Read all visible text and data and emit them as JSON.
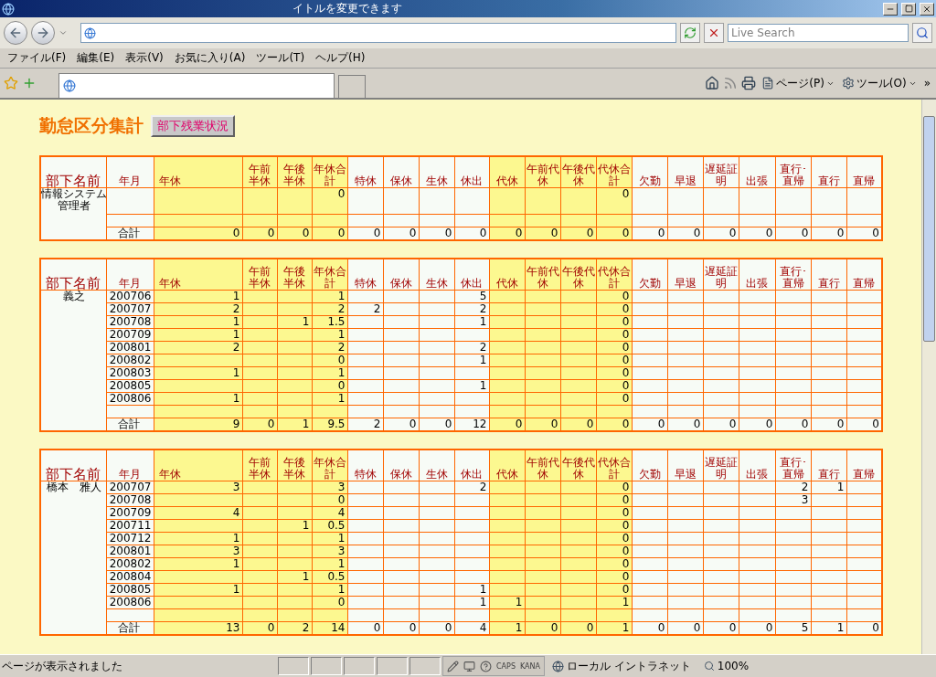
{
  "browser": {
    "title": "イトルを変更できます",
    "search_placeholder": "Live Search",
    "menu": [
      "ファイル(F)",
      "編集(E)",
      "表示(V)",
      "お気に入り(A)",
      "ツール(T)",
      "ヘルプ(H)"
    ],
    "command_bar": [
      {
        "kind": "page",
        "label": "ページ(P)"
      },
      {
        "kind": "tools",
        "label": "ツール(O)"
      }
    ],
    "more": "»"
  },
  "page": {
    "title": "勤怠区分集計",
    "button": "部下残業状況"
  },
  "groups": [
    {
      "name_header": "部下名前",
      "month_header": "年月",
      "name": "情報システム管理者",
      "columns": [
        {
          "label": "年休",
          "highlight": true
        },
        {
          "label": "午前半休",
          "highlight": true
        },
        {
          "label": "午後半休",
          "highlight": true
        },
        {
          "label": "年休合計",
          "highlight": true
        },
        {
          "label": "特休",
          "highlight": false
        },
        {
          "label": "保休",
          "highlight": false
        },
        {
          "label": "生休",
          "highlight": false
        },
        {
          "label": "休出",
          "highlight": false
        },
        {
          "label": "代休",
          "highlight": true
        },
        {
          "label": "午前代休",
          "highlight": true
        },
        {
          "label": "午後代休",
          "highlight": true
        },
        {
          "label": "代休合計",
          "highlight": true
        },
        {
          "label": "欠勤",
          "highlight": false
        },
        {
          "label": "早退",
          "highlight": false
        },
        {
          "label": "遅延証明",
          "highlight": false
        },
        {
          "label": "出張",
          "highlight": false
        },
        {
          "label": "直行･直帰",
          "highlight": false
        },
        {
          "label": "直行",
          "highlight": false
        },
        {
          "label": "直帰",
          "highlight": false
        }
      ],
      "rows": [
        {
          "kind": "tall",
          "cells": [
            null,
            null,
            null,
            "0",
            null,
            null,
            null,
            null,
            null,
            null,
            null,
            "0",
            null,
            null,
            null,
            null,
            null,
            null,
            null
          ]
        },
        {
          "kind": "blank"
        }
      ],
      "total_label": "合計",
      "totals": [
        "0",
        "0",
        "0",
        "0",
        "0",
        "0",
        "0",
        "0",
        "0",
        "0",
        "0",
        "0",
        "0",
        "0",
        "0",
        "0",
        "0",
        "0",
        "0"
      ]
    },
    {
      "name_header": "部下名前",
      "month_header": "年月",
      "name": "義之",
      "columns": [
        {
          "label": "年休",
          "highlight": true
        },
        {
          "label": "午前半休",
          "highlight": true
        },
        {
          "label": "午後半休",
          "highlight": true
        },
        {
          "label": "年休合計",
          "highlight": true
        },
        {
          "label": "特休",
          "highlight": false
        },
        {
          "label": "保休",
          "highlight": false
        },
        {
          "label": "生休",
          "highlight": false
        },
        {
          "label": "休出",
          "highlight": false
        },
        {
          "label": "代休",
          "highlight": true
        },
        {
          "label": "午前代休",
          "highlight": true
        },
        {
          "label": "午後代休",
          "highlight": true
        },
        {
          "label": "代休合計",
          "highlight": true
        },
        {
          "label": "欠勤",
          "highlight": false
        },
        {
          "label": "早退",
          "highlight": false
        },
        {
          "label": "遅延証明",
          "highlight": false
        },
        {
          "label": "出張",
          "highlight": false
        },
        {
          "label": "直行･直帰",
          "highlight": false
        },
        {
          "label": "直行",
          "highlight": false
        },
        {
          "label": "直帰",
          "highlight": false
        }
      ],
      "rows": [
        {
          "kind": "data",
          "month": "200706",
          "cells": [
            "1",
            null,
            null,
            "1",
            null,
            null,
            null,
            "5",
            null,
            null,
            null,
            "0",
            null,
            null,
            null,
            null,
            null,
            null,
            null
          ]
        },
        {
          "kind": "data",
          "month": "200707",
          "cells": [
            "2",
            null,
            null,
            "2",
            "2",
            null,
            null,
            "2",
            null,
            null,
            null,
            "0",
            null,
            null,
            null,
            null,
            null,
            null,
            null
          ]
        },
        {
          "kind": "data",
          "month": "200708",
          "cells": [
            "1",
            null,
            "1",
            "1.5",
            null,
            null,
            null,
            "1",
            null,
            null,
            null,
            "0",
            null,
            null,
            null,
            null,
            null,
            null,
            null
          ]
        },
        {
          "kind": "data",
          "month": "200709",
          "cells": [
            "1",
            null,
            null,
            "1",
            null,
            null,
            null,
            null,
            null,
            null,
            null,
            "0",
            null,
            null,
            null,
            null,
            null,
            null,
            null
          ]
        },
        {
          "kind": "data",
          "month": "200801",
          "cells": [
            "2",
            null,
            null,
            "2",
            null,
            null,
            null,
            "2",
            null,
            null,
            null,
            "0",
            null,
            null,
            null,
            null,
            null,
            null,
            null
          ]
        },
        {
          "kind": "data",
          "month": "200802",
          "cells": [
            null,
            null,
            null,
            "0",
            null,
            null,
            null,
            "1",
            null,
            null,
            null,
            "0",
            null,
            null,
            null,
            null,
            null,
            null,
            null
          ]
        },
        {
          "kind": "data",
          "month": "200803",
          "cells": [
            "1",
            null,
            null,
            "1",
            null,
            null,
            null,
            null,
            null,
            null,
            null,
            "0",
            null,
            null,
            null,
            null,
            null,
            null,
            null
          ]
        },
        {
          "kind": "data",
          "month": "200805",
          "cells": [
            null,
            null,
            null,
            "0",
            null,
            null,
            null,
            "1",
            null,
            null,
            null,
            "0",
            null,
            null,
            null,
            null,
            null,
            null,
            null
          ]
        },
        {
          "kind": "data",
          "month": "200806",
          "cells": [
            "1",
            null,
            null,
            "1",
            null,
            null,
            null,
            null,
            null,
            null,
            null,
            "0",
            null,
            null,
            null,
            null,
            null,
            null,
            null
          ]
        },
        {
          "kind": "blank"
        }
      ],
      "total_label": "合計",
      "totals": [
        "9",
        "0",
        "1",
        "9.5",
        "2",
        "0",
        "0",
        "12",
        "0",
        "0",
        "0",
        "0",
        "0",
        "0",
        "0",
        "0",
        "0",
        "0",
        "0"
      ]
    },
    {
      "name_header": "部下名前",
      "month_header": "年月",
      "name": "橋本　雅人",
      "columns": [
        {
          "label": "年休",
          "highlight": true
        },
        {
          "label": "午前半休",
          "highlight": true
        },
        {
          "label": "午後半休",
          "highlight": true
        },
        {
          "label": "年休合計",
          "highlight": true
        },
        {
          "label": "特休",
          "highlight": false
        },
        {
          "label": "保休",
          "highlight": false
        },
        {
          "label": "生休",
          "highlight": false
        },
        {
          "label": "休出",
          "highlight": false
        },
        {
          "label": "代休",
          "highlight": true
        },
        {
          "label": "午前代休",
          "highlight": true
        },
        {
          "label": "午後代休",
          "highlight": true
        },
        {
          "label": "代休合計",
          "highlight": true
        },
        {
          "label": "欠勤",
          "highlight": false
        },
        {
          "label": "早退",
          "highlight": false
        },
        {
          "label": "遅延証明",
          "highlight": false
        },
        {
          "label": "出張",
          "highlight": false
        },
        {
          "label": "直行･直帰",
          "highlight": false
        },
        {
          "label": "直行",
          "highlight": false
        },
        {
          "label": "直帰",
          "highlight": false
        }
      ],
      "rows": [
        {
          "kind": "data",
          "month": "200707",
          "cells": [
            "3",
            null,
            null,
            "3",
            null,
            null,
            null,
            "2",
            null,
            null,
            null,
            "0",
            null,
            null,
            null,
            null,
            "2",
            "1",
            null
          ]
        },
        {
          "kind": "data",
          "month": "200708",
          "cells": [
            null,
            null,
            null,
            "0",
            null,
            null,
            null,
            null,
            null,
            null,
            null,
            "0",
            null,
            null,
            null,
            null,
            "3",
            null,
            null
          ]
        },
        {
          "kind": "data",
          "month": "200709",
          "cells": [
            "4",
            null,
            null,
            "4",
            null,
            null,
            null,
            null,
            null,
            null,
            null,
            "0",
            null,
            null,
            null,
            null,
            null,
            null,
            null
          ]
        },
        {
          "kind": "data",
          "month": "200711",
          "cells": [
            null,
            null,
            "1",
            "0.5",
            null,
            null,
            null,
            null,
            null,
            null,
            null,
            "0",
            null,
            null,
            null,
            null,
            null,
            null,
            null
          ]
        },
        {
          "kind": "data",
          "month": "200712",
          "cells": [
            "1",
            null,
            null,
            "1",
            null,
            null,
            null,
            null,
            null,
            null,
            null,
            "0",
            null,
            null,
            null,
            null,
            null,
            null,
            null
          ]
        },
        {
          "kind": "data",
          "month": "200801",
          "cells": [
            "3",
            null,
            null,
            "3",
            null,
            null,
            null,
            null,
            null,
            null,
            null,
            "0",
            null,
            null,
            null,
            null,
            null,
            null,
            null
          ]
        },
        {
          "kind": "data",
          "month": "200802",
          "cells": [
            "1",
            null,
            null,
            "1",
            null,
            null,
            null,
            null,
            null,
            null,
            null,
            "0",
            null,
            null,
            null,
            null,
            null,
            null,
            null
          ]
        },
        {
          "kind": "data",
          "month": "200804",
          "cells": [
            null,
            null,
            "1",
            "0.5",
            null,
            null,
            null,
            null,
            null,
            null,
            null,
            "0",
            null,
            null,
            null,
            null,
            null,
            null,
            null
          ]
        },
        {
          "kind": "data",
          "month": "200805",
          "cells": [
            "1",
            null,
            null,
            "1",
            null,
            null,
            null,
            "1",
            null,
            null,
            null,
            "0",
            null,
            null,
            null,
            null,
            null,
            null,
            null
          ]
        },
        {
          "kind": "data",
          "month": "200806",
          "cells": [
            null,
            null,
            null,
            "0",
            null,
            null,
            null,
            "1",
            "1",
            null,
            null,
            "1",
            null,
            null,
            null,
            null,
            null,
            null,
            null
          ]
        },
        {
          "kind": "blank"
        }
      ],
      "total_label": "合計",
      "totals": [
        "13",
        "0",
        "2",
        "14",
        "0",
        "0",
        "0",
        "4",
        "1",
        "0",
        "0",
        "1",
        "0",
        "0",
        "0",
        "0",
        "5",
        "1",
        "0"
      ]
    }
  ],
  "status_bar": {
    "text": "ページが表示されました",
    "caps": "CAPS",
    "kana": "KANA",
    "zone": "ローカル イントラネット",
    "zoom": "100%"
  }
}
